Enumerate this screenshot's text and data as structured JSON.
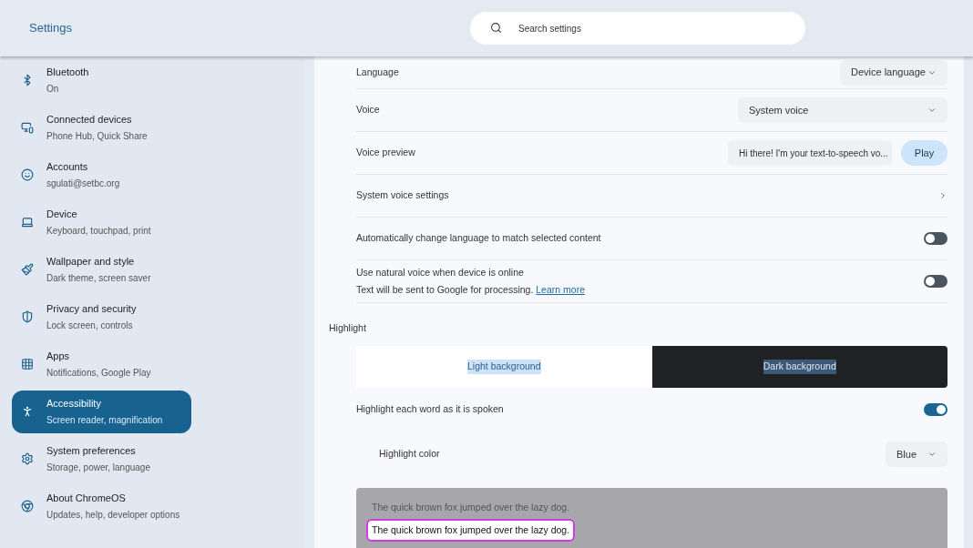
{
  "header": {
    "title": "Settings",
    "search": {
      "placeholder": "Search settings"
    }
  },
  "sidebar": {
    "items": [
      {
        "label": "Bluetooth",
        "sublabel": "On",
        "selected": false
      },
      {
        "label": "Connected devices",
        "sublabel": "Phone Hub, Quick Share",
        "selected": false
      },
      {
        "label": "Accounts",
        "sublabel": "sgulati@setbc.org",
        "selected": false
      },
      {
        "label": "Device",
        "sublabel": "Keyboard, touchpad, print",
        "selected": false
      },
      {
        "label": "Wallpaper and style",
        "sublabel": "Dark theme, screen saver",
        "selected": false
      },
      {
        "label": "Privacy and security",
        "sublabel": "Lock screen, controls",
        "selected": false
      },
      {
        "label": "Apps",
        "sublabel": "Notifications, Google Play",
        "selected": false
      },
      {
        "label": "Accessibility",
        "sublabel": "Screen reader, magnification",
        "selected": true
      },
      {
        "label": "System preferences",
        "sublabel": "Storage, power, language",
        "selected": false
      },
      {
        "label": "About ChromeOS",
        "sublabel": "Updates, help, developer options",
        "selected": false
      }
    ]
  },
  "settings": [
    {
      "kind": "dropdown",
      "label": "Language",
      "value": "Device language"
    },
    {
      "kind": "dropdown",
      "label": "Voice",
      "value": "System voice"
    },
    {
      "kind": "preview",
      "label": "Voice preview",
      "value": "Hi there! I'm your text-to-speech vo...",
      "button": "Play"
    },
    {
      "kind": "link",
      "label": "System voice settings"
    },
    {
      "kind": "toggle",
      "label": "Automatically change language to match selected content",
      "on": false
    },
    {
      "kind": "toggle",
      "label": "Use natural voice when device is online",
      "description": "Text will be sent to Google for processing.",
      "link": "Learn more",
      "on": false
    }
  ],
  "highlight": {
    "heading": "Highlight",
    "themes": [
      {
        "label": "Light background",
        "kind": "light"
      },
      {
        "label": "Dark background",
        "kind": "dark"
      }
    ],
    "word_toggle": {
      "label": "Highlight each word as it is spoken",
      "on": true
    },
    "color": {
      "label": "Highlight color",
      "value": "Blue"
    },
    "preview_lines": [
      {
        "text": "The quick brown fox jumped over the lazy dog.",
        "selected": false
      },
      {
        "text": "The quick brown fox jumped over the lazy dog.",
        "selected": true
      }
    ]
  }
}
